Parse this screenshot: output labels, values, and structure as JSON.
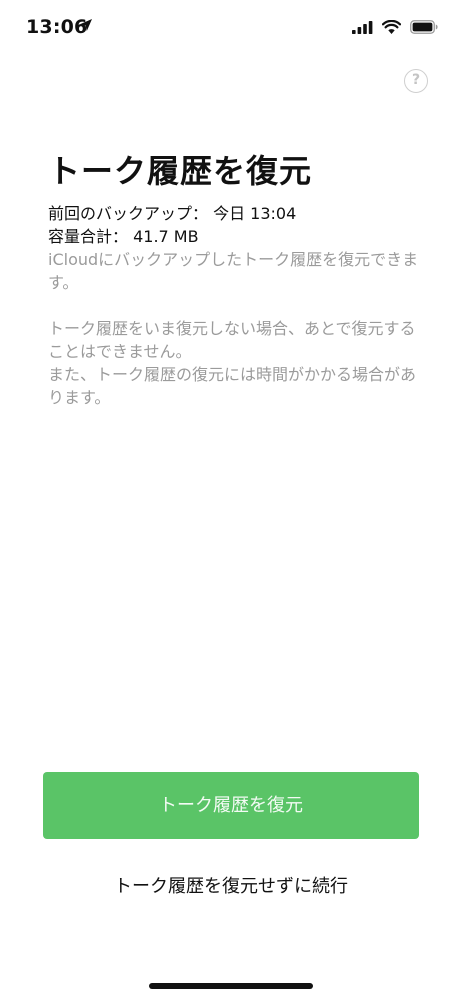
{
  "status_bar": {
    "time": "13:06",
    "icons": [
      "location-arrow-icon",
      "cellular-signal-icon",
      "wifi-icon",
      "battery-icon"
    ]
  },
  "help": {
    "label": "?"
  },
  "title": "トーク履歴を復元",
  "backup_info": {
    "last_backup": "前回のバックアップ： 今日 13:04",
    "total_size": "容量合計： 41.7 MB"
  },
  "description": {
    "line1": "iCloudにバックアップしたトーク履歴を復元できます。",
    "line2": "トーク履歴をいま復元しない場合、あとで復元することはできません。",
    "line3": "また、トーク履歴の復元には時間がかかる場合があります。"
  },
  "buttons": {
    "restore": "トーク履歴を復元",
    "skip": "トーク履歴を復元せずに続行"
  },
  "colors": {
    "primary_button": "#5ac467",
    "secondary_text": "#9b9b9b"
  }
}
